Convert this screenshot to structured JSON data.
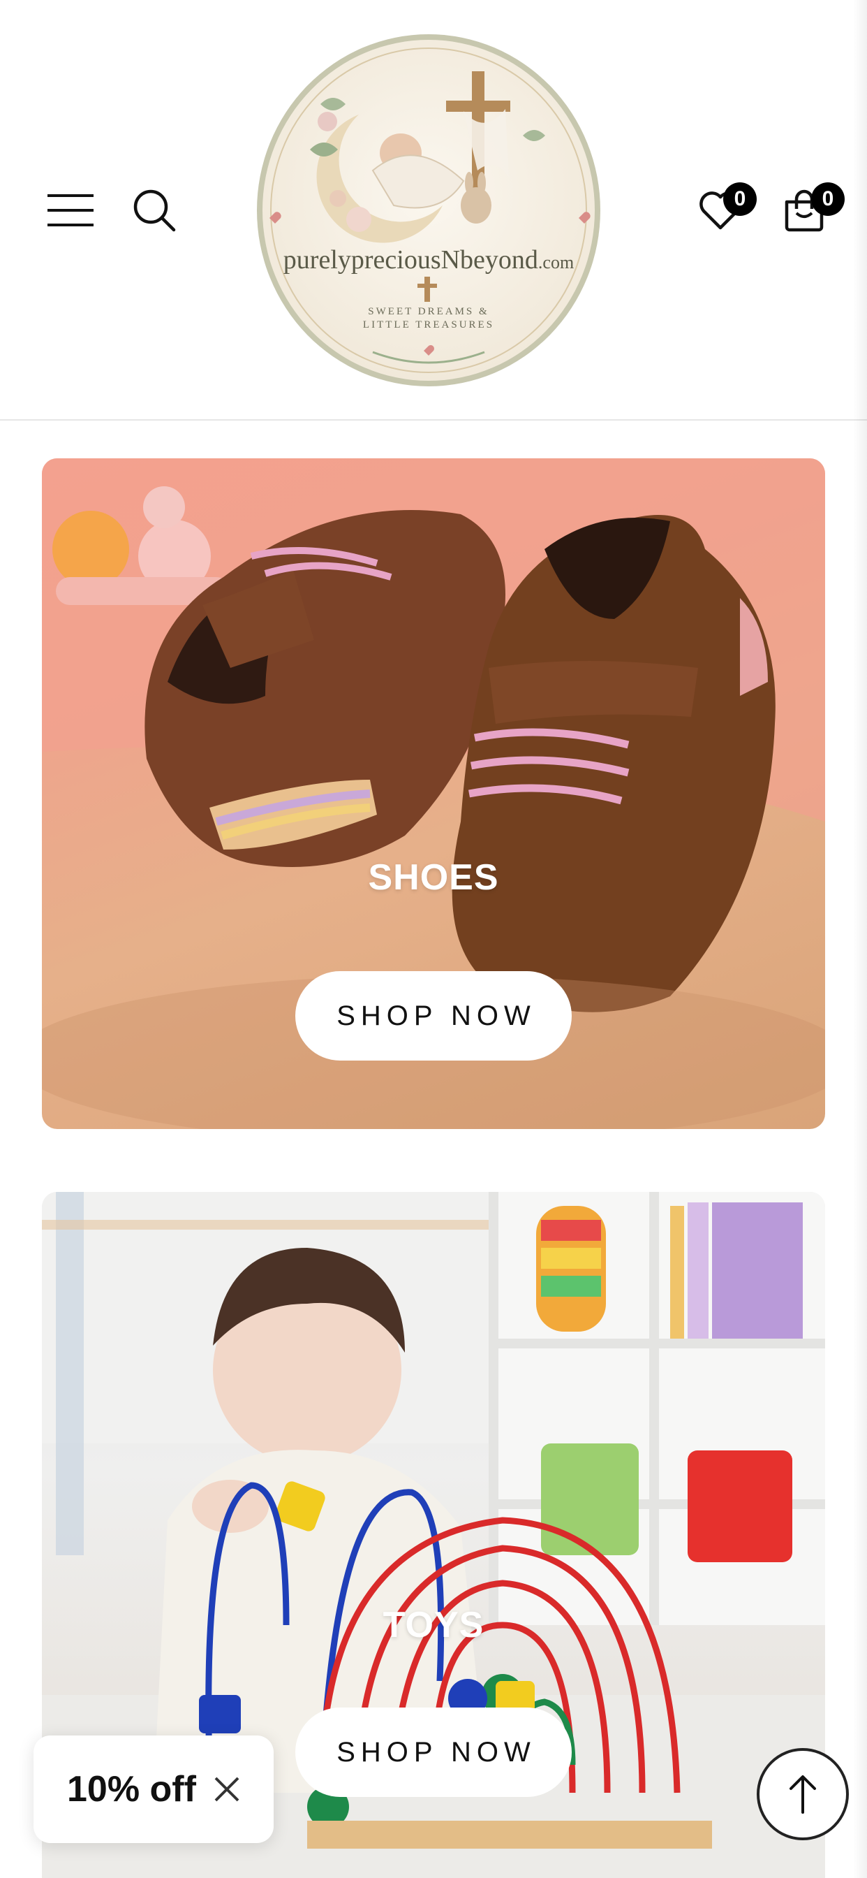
{
  "header": {
    "logo": {
      "brand": "purelypreciousNbeyond",
      "domain_suffix": ".com",
      "tagline_line1": "SWEET DREAMS &",
      "tagline_line2": "LITTLE TREASURES"
    },
    "icons": {
      "menu": "hamburger-menu-icon",
      "search": "search-icon",
      "wishlist": "heart-icon",
      "cart": "shopping-bag-icon"
    },
    "wishlist_count": "0",
    "cart_count": "0"
  },
  "banners": [
    {
      "title": "SHOES",
      "button_label": "SHOP NOW"
    },
    {
      "title": "TOYS",
      "button_label": "SHOP NOW"
    }
  ],
  "discount_popup": {
    "label": "10% off",
    "close_icon": "close-icon"
  },
  "scroll_top": {
    "icon": "arrow-up-icon"
  },
  "colors": {
    "badge": "#000000",
    "button_bg": "#ffffff",
    "text": "#111111"
  }
}
